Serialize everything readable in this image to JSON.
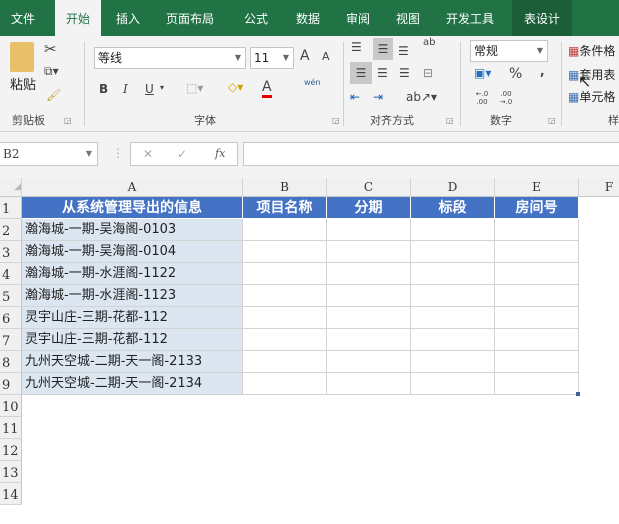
{
  "tabs": [
    "文件",
    "开始",
    "插入",
    "页面布局",
    "公式",
    "数据",
    "审阅",
    "视图",
    "开发工具",
    "表设计"
  ],
  "ribbon": {
    "clipboard": {
      "paste": "粘贴",
      "label": "剪贴板"
    },
    "font": {
      "name": "等线",
      "size": "11",
      "bold": "B",
      "italic": "I",
      "underline": "U",
      "grow": "A",
      "shrink": "A",
      "font_color": "A",
      "phonetic": "wén",
      "label": "字体"
    },
    "alignment": {
      "label": "对齐方式",
      "wrap": "ab"
    },
    "number": {
      "format": "常规",
      "percent": "%",
      "comma": ",",
      "inc_decimal": "←.0 .00",
      "dec_decimal": ".00 →.0",
      "label": "数字"
    },
    "styles": {
      "conditional": "条件格",
      "table": "套用表",
      "cell": "单元格",
      "label": "样"
    }
  },
  "formula_bar": {
    "name_box": "B2",
    "cancel": "✕",
    "enter": "✓",
    "fx": "fx",
    "value": ""
  },
  "columns": [
    "A",
    "B",
    "C",
    "D",
    "E",
    "F"
  ],
  "rows": [
    "1",
    "2",
    "3",
    "4",
    "5",
    "6",
    "7",
    "8",
    "9",
    "10",
    "11",
    "12",
    "13",
    "14"
  ],
  "headers": [
    "从系统管理导出的信息",
    "项目名称",
    "分期",
    "标段",
    "房间号"
  ],
  "data": [
    "瀚海城-一期-吴海阁-0103",
    "瀚海城-一期-吴海阁-0104",
    "瀚海城-一期-水涯阁-1122",
    "瀚海城-一期-水涯阁-1123",
    "灵宇山庄-三期-花都-112",
    "灵宇山庄-三期-花都-112",
    "九州天空城-二期-天一阁-2133",
    "九州天空城-二期-天一阁-2134"
  ],
  "colors": {
    "ribbon_green": "#217346",
    "header_blue": "#4472c4",
    "col_a_fill": "#dce6f1"
  }
}
